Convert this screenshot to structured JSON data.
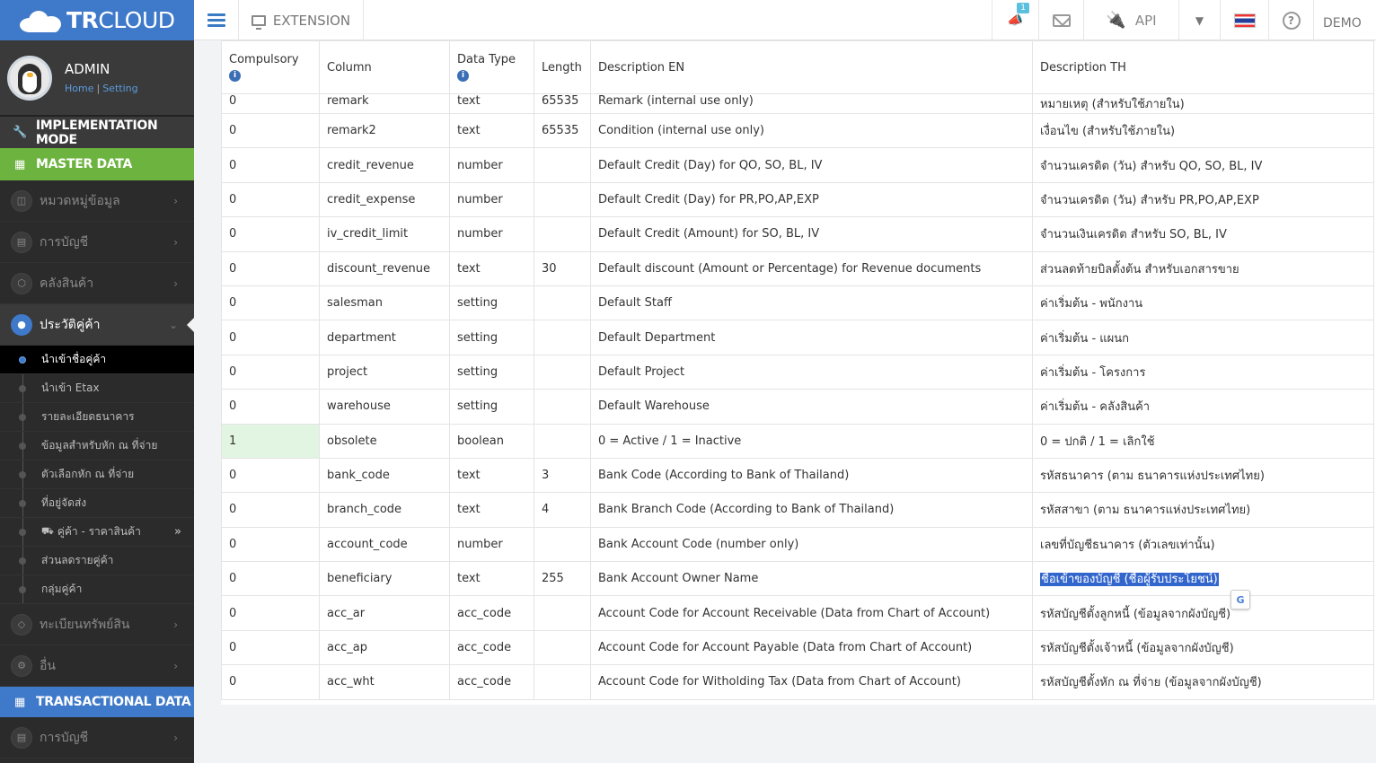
{
  "app": {
    "logo_text_bold": "TR",
    "logo_text": "CLOUD"
  },
  "user": {
    "name": "ADMIN",
    "home_link": "Home",
    "setting_link": "Setting"
  },
  "sidebar": {
    "implementation": "IMPLEMENTATION MODE",
    "master_data": "MASTER DATA",
    "transactional_data": "TRANSACTIONAL DATA",
    "items": [
      {
        "label": "หมวดหมู่ข้อมูล"
      },
      {
        "label": "การบัญชี"
      },
      {
        "label": "คลังสินค้า"
      },
      {
        "label": "ประวัติคู่ค้า"
      },
      {
        "label": "ทะเบียนทรัพย์สิน"
      },
      {
        "label": "อื่น"
      },
      {
        "label": "การบัญชี"
      }
    ],
    "sub_items": [
      {
        "label": "นำเข้าชื่อคู่ค้า"
      },
      {
        "label": "นำเข้า Etax"
      },
      {
        "label": "รายละเอียดธนาคาร"
      },
      {
        "label": "ข้อมูลสำหรับหัก ณ ที่จ่าย"
      },
      {
        "label": "ตัวเลือกหัก ณ ที่จ่าย"
      },
      {
        "label": "ที่อยู่จัดส่ง"
      },
      {
        "label": "คู่ค้า - ราคาสินค้า"
      },
      {
        "label": "ส่วนลดรายคู่ค้า"
      },
      {
        "label": "กลุ่มคู่ค้า"
      }
    ]
  },
  "topbar": {
    "extension": "EXTENSION",
    "notification_count": "1",
    "api": "API",
    "demo": "DEMO"
  },
  "table": {
    "headers": [
      "Compulsory",
      "Column",
      "Data Type",
      "Length",
      "Description EN",
      "Description TH"
    ],
    "rows": [
      [
        "0",
        "remark",
        "text",
        "65535",
        "Remark (internal use only)",
        "หมายเหตุ (สำหรับใช้ภายใน)"
      ],
      [
        "0",
        "remark2",
        "text",
        "65535",
        "Condition (internal use only)",
        "เงื่อนไข (สำหรับใช้ภายใน)"
      ],
      [
        "0",
        "credit_revenue",
        "number",
        "",
        "Default Credit (Day) for QO, SO, BL, IV",
        "จำนวนเครดิต (วัน) สำหรับ QO, SO, BL, IV"
      ],
      [
        "0",
        "credit_expense",
        "number",
        "",
        "Default Credit (Day) for PR,PO,AP,EXP",
        "จำนวนเครดิต (วัน) สำหรับ PR,PO,AP,EXP"
      ],
      [
        "0",
        "iv_credit_limit",
        "number",
        "",
        "Default Credit (Amount) for SO, BL, IV",
        "จำนวนเงินเครดิต สำหรับ SO, BL, IV"
      ],
      [
        "0",
        "discount_revenue",
        "text",
        "30",
        "Default discount (Amount or Percentage) for Revenue documents",
        "ส่วนลดท้ายบิลตั้งต้น สำหรับเอกสารขาย"
      ],
      [
        "0",
        "salesman",
        "setting",
        "",
        "Default Staff",
        "ค่าเริ่มต้น - พนักงาน"
      ],
      [
        "0",
        "department",
        "setting",
        "",
        "Default Department",
        "ค่าเริ่มต้น - แผนก"
      ],
      [
        "0",
        "project",
        "setting",
        "",
        "Default Project",
        "ค่าเริ่มต้น - โครงการ"
      ],
      [
        "0",
        "warehouse",
        "setting",
        "",
        "Default Warehouse",
        "ค่าเริ่มต้น - คลังสินค้า"
      ],
      [
        "1",
        "obsolete",
        "boolean",
        "",
        "0 = Active / 1 = Inactive",
        "0 = ปกติ / 1 = เลิกใช้"
      ],
      [
        "0",
        "bank_code",
        "text",
        "3",
        "Bank Code (According to Bank of Thailand)",
        "รหัสธนาคาร (ตาม ธนาคารแห่งประเทศไทย)"
      ],
      [
        "0",
        "branch_code",
        "text",
        "4",
        "Bank Branch Code (According to Bank of Thailand)",
        "รหัสสาขา (ตาม ธนาคารแห่งประเทศไทย)"
      ],
      [
        "0",
        "account_code",
        "number",
        "",
        "Bank Account Code (number only)",
        "เลขที่บัญชีธนาคาร (ตัวเลขเท่านั้น)"
      ],
      [
        "0",
        "beneficiary",
        "text",
        "255",
        "Bank Account Owner Name",
        "ชื่อเข้าของบัญชี (ชื่อผู้รับประโยชน์)"
      ],
      [
        "0",
        "acc_ar",
        "acc_code",
        "",
        "Account Code for Account Receivable (Data from Chart of Account)",
        "รหัสบัญชีตั้งลูกหนี้ (ข้อมูลจากผังบัญชี)"
      ],
      [
        "0",
        "acc_ap",
        "acc_code",
        "",
        "Account Code for Account Payable (Data from Chart of Account)",
        "รหัสบัญชีตั้งเจ้าหนี้ (ข้อมูลจากผังบัญชี)"
      ],
      [
        "0",
        "acc_wht",
        "acc_code",
        "",
        "Account Code for Witholding Tax (Data from Chart of Account)",
        "รหัสบัญชีตั้งหัก ณ ที่จ่าย (ข้อมูลจากผังบัญชี)"
      ]
    ]
  },
  "colors": {
    "accent_blue": "#3f79c9",
    "master_green": "#6cb33f",
    "sidebar_dark": "#2b2b2b",
    "highlight_green": "#e2f4e2"
  }
}
